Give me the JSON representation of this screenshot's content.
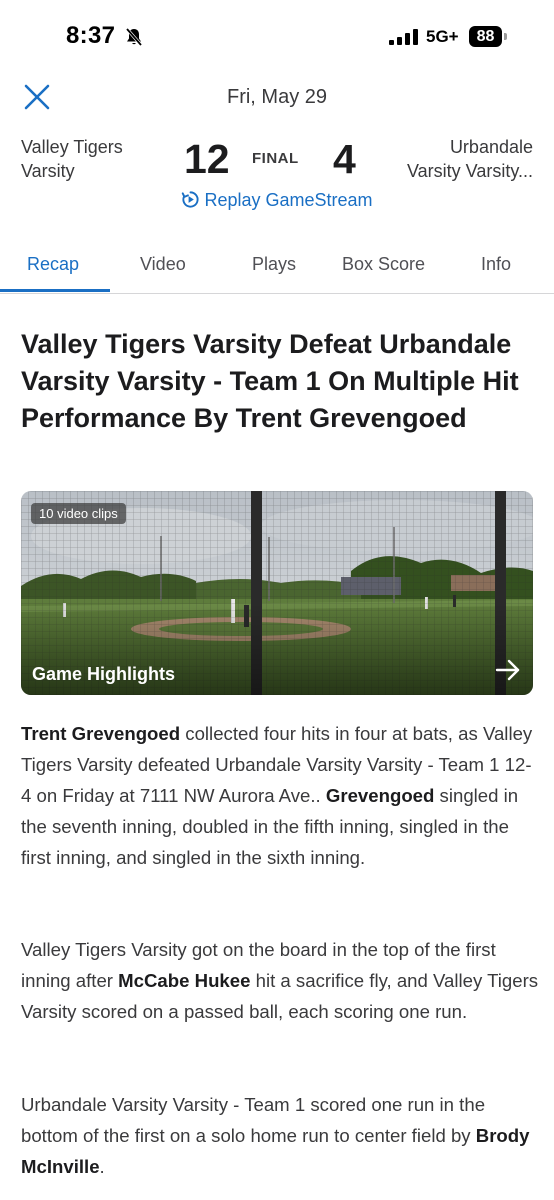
{
  "status_bar": {
    "time": "8:37",
    "network": "5G+",
    "battery": "88"
  },
  "header": {
    "date": "Fri, May 29"
  },
  "scoreboard": {
    "home_team_line1": "Valley Tigers",
    "home_team_line2": "Varsity",
    "home_score": "12",
    "status": "FINAL",
    "away_score": "4",
    "away_team_line1": "Urbandale",
    "away_team_line2": "Varsity Varsity..."
  },
  "replay": {
    "label": "Replay GameStream"
  },
  "tabs": [
    {
      "label": "Recap",
      "active": true
    },
    {
      "label": "Video",
      "active": false
    },
    {
      "label": "Plays",
      "active": false
    },
    {
      "label": "Box Score",
      "active": false
    },
    {
      "label": "Info",
      "active": false
    }
  ],
  "article": {
    "headline": "Valley Tigers Varsity Defeat Urbandale Varsity Varsity - Team 1 On Multiple Hit Performance By Trent Grevengoed",
    "video": {
      "badge": "10 video clips",
      "title": "Game Highlights"
    },
    "p1_name": "Trent Grevengoed",
    "p1_text1": " collected four hits in four at bats, as Valley Tigers Varsity defeated Urbandale Varsity Varsity - Team 1 12-4 on Friday at 7111 NW Aurora Ave.. ",
    "p1_name2": "Grevengoed",
    "p1_text2": " singled in the seventh inning, doubled in the fifth inning, singled in the first inning, and singled in the sixth inning.",
    "p2_text1": "Valley Tigers Varsity got on the board in the top of the first inning after ",
    "p2_name": "McCabe Hukee",
    "p2_text2": " hit a sacrifice fly, and Valley Tigers Varsity scored on a passed ball, each scoring one run.",
    "p3_text1": "Urbandale Varsity Varsity - Team 1 scored one run in the bottom of the first on a solo home run to center field by ",
    "p3_name": "Brody McInville",
    "p3_text2": "."
  },
  "colors": {
    "accent": "#1a6fc4",
    "text": "#1c1c1e",
    "muted": "#3a3a3c"
  }
}
